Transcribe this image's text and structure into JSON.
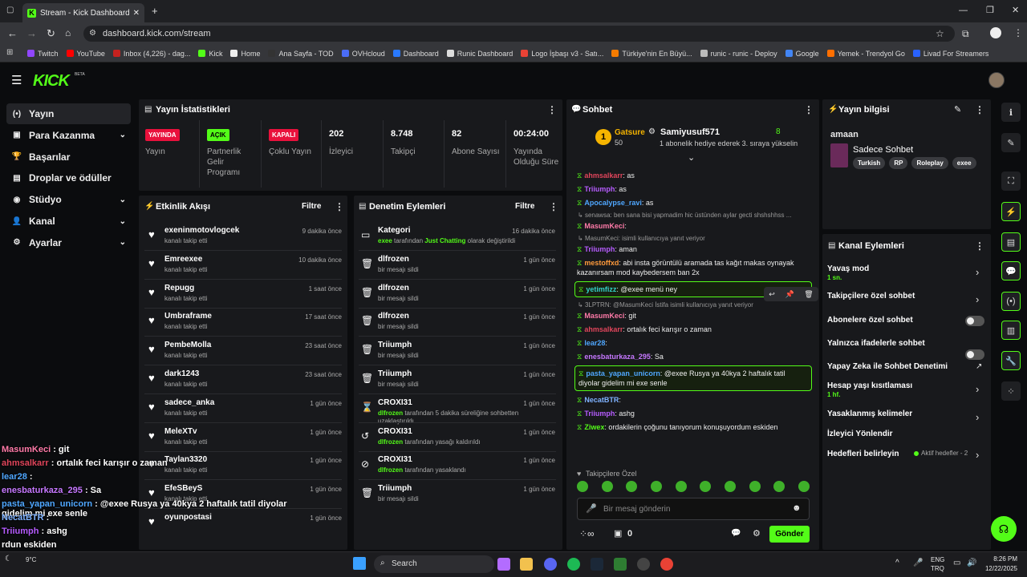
{
  "browser": {
    "tab_title": "Stream - Kick Dashboard",
    "url": "dashboard.kick.com/stream",
    "bookmarks": [
      "Twitch",
      "YouTube",
      "Inbox (4,226) - dag...",
      "Kick",
      "Home",
      "Ana Sayfa - TOD",
      "OVHcloud",
      "Dashboard",
      "Runic Dashboard",
      "Logo İşbaşı v3 - Satı...",
      "Türkiye'nin En Büyü...",
      "runic - runic - Deploy",
      "Google",
      "Yemek - Trendyol Go",
      "Livad For Streamers"
    ]
  },
  "header": {
    "logo": "KICK",
    "beta": "BETA"
  },
  "sidebar": {
    "items": [
      {
        "label": "Yayın",
        "icon": "(•)",
        "chevron": ""
      },
      {
        "label": "Para Kazanma",
        "icon": "▣",
        "chevron": "⌄"
      },
      {
        "label": "Başarılar",
        "icon": "🏆",
        "chevron": ""
      },
      {
        "label": "Droplar ve ödüller",
        "icon": "▤",
        "chevron": ""
      },
      {
        "label": "Stüdyo",
        "icon": "◉",
        "chevron": "⌄"
      },
      {
        "label": "Kanal",
        "icon": "👤",
        "chevron": "⌄"
      },
      {
        "label": "Ayarlar",
        "icon": "⚙",
        "chevron": "⌄"
      }
    ]
  },
  "stats": {
    "title": "Yayın İstatistikleri",
    "items": [
      {
        "badge": "YAYINDA",
        "label": "Yayın"
      },
      {
        "badge": "AÇIK",
        "label": "Partnerlik Gelir Programı"
      },
      {
        "badge": "KAPALI",
        "label": "Çoklu Yayın"
      },
      {
        "value": "202",
        "label": "İzleyici"
      },
      {
        "value": "8.748",
        "label": "Takipçi"
      },
      {
        "value": "82",
        "label": "Abone Sayısı"
      },
      {
        "value": "00:24:00",
        "label": "Yayında Olduğu Süre"
      }
    ]
  },
  "activity": {
    "title": "Etkinlik Akışı",
    "filter": "Filtre",
    "rows": [
      {
        "name": "exeninmotovlogcek",
        "action": "kanalı takip etti",
        "time": "9 dakika önce"
      },
      {
        "name": "Emreexee",
        "action": "kanalı takip etti",
        "time": "10 dakika önce"
      },
      {
        "name": "Repugg",
        "action": "kanalı takip etti",
        "time": "1 saat önce"
      },
      {
        "name": "Umbraframe",
        "action": "kanalı takip etti",
        "time": "17 saat önce"
      },
      {
        "name": "PembeMolla",
        "action": "kanalı takip etti",
        "time": "23 saat önce"
      },
      {
        "name": "dark1243",
        "action": "kanalı takip etti",
        "time": "23 saat önce"
      },
      {
        "name": "sadece_anka",
        "action": "kanalı takip etti",
        "time": "1 gün önce"
      },
      {
        "name": "MeleXTv",
        "action": "kanalı takip etti",
        "time": "1 gün önce"
      },
      {
        "name": "Taylan3320",
        "action": "kanalı takip etti",
        "time": "1 gün önce"
      },
      {
        "name": "EfeSBeyS",
        "action": "kanalı takip etti",
        "time": "1 gün önce"
      },
      {
        "name": "oyunpostasi",
        "action": "",
        "time": "1 gün önce"
      }
    ]
  },
  "moderation": {
    "title": "Denetim Eylemleri",
    "filter": "Filtre",
    "rows": [
      {
        "icon": "▭",
        "name": "Kategori",
        "pre": "exee",
        "mid": " tarafından ",
        "post": "Just Chatting",
        "tail": " olarak değiştirildi",
        "time": "16 dakika önce"
      },
      {
        "icon": "🗑",
        "name": "dlfrozen",
        "pre": "",
        "mid": "bir mesajı sildi",
        "post": "",
        "tail": "",
        "time": "1 gün önce"
      },
      {
        "icon": "🗑",
        "name": "dlfrozen",
        "pre": "",
        "mid": "bir mesajı sildi",
        "post": "",
        "tail": "",
        "time": "1 gün önce"
      },
      {
        "icon": "🗑",
        "name": "dlfrozen",
        "pre": "",
        "mid": "bir mesajı sildi",
        "post": "",
        "tail": "",
        "time": "1 gün önce"
      },
      {
        "icon": "🗑",
        "name": "Triiumph",
        "pre": "",
        "mid": "bir mesajı sildi",
        "post": "",
        "tail": "",
        "time": "1 gün önce"
      },
      {
        "icon": "🗑",
        "name": "Triiumph",
        "pre": "",
        "mid": "bir mesajı sildi",
        "post": "",
        "tail": "",
        "time": "1 gün önce"
      },
      {
        "icon": "⌛",
        "name": "CROXI31",
        "pre": "dlfrozen",
        "mid": " tarafından 5 dakika süreliğine sohbetten uzaklaştırıldı",
        "post": "",
        "tail": "",
        "time": "1 gün önce"
      },
      {
        "icon": "↺",
        "name": "CROXI31",
        "pre": "dlfrozen",
        "mid": " tarafından yasağı kaldırıldı",
        "post": "",
        "tail": "",
        "time": "1 gün önce"
      },
      {
        "icon": "⊘",
        "name": "CROXI31",
        "pre": "dlfrozen",
        "mid": " tarafından yasaklandı",
        "post": "",
        "tail": "",
        "time": "1 gün önce"
      },
      {
        "icon": "🗑",
        "name": "Triiumph",
        "pre": "",
        "mid": "bir mesajı sildi",
        "post": "",
        "tail": "",
        "time": "1 gün önce"
      }
    ]
  },
  "chat": {
    "title": "Sohbet",
    "pinned": {
      "tier": "Gatsure",
      "tier_count": "50",
      "user": "Samiyusuf571",
      "count": "8",
      "message": "1 abonelik hediye ederek 3. sıraya yükselin"
    },
    "messages": [
      {
        "user": "ahmsalkarr",
        "color": "#e0455b",
        "text": ": as"
      },
      {
        "user": "Triiumph",
        "color": "#b65cff",
        "text": ": as"
      },
      {
        "user": "Apocalypse_ravi",
        "color": "#4fa7ff",
        "text": ": as"
      },
      {
        "reply": "senawsa: ben sana bisi yapmadim hic üstünden aylar gecti shshshhss ..."
      },
      {
        "user": "MasumKeci",
        "color": "#ff7aa8",
        "text": ":"
      },
      {
        "reply": "MasumKeci: isimli kullanıcıya yanıt veriyor"
      },
      {
        "user": "Triiumph",
        "color": "#b65cff",
        "text": ": aman"
      },
      {
        "user": "mestoffxd",
        "color": "#ff9a3c",
        "text": ": abi insta görüntülü aramada tas kağıt makas oynayak kazanırsam mod kaybedersem ban 2x"
      },
      {
        "user": "yetimfizz",
        "color": "#34d1c9",
        "text": ": @exee menü ney",
        "highlight": true
      },
      {
        "reply": "3LPTRN: @MasumKeci İstifa isimli kullanıcıya yanıt veriyor"
      },
      {
        "user": "MasumKeci",
        "color": "#ff7aa8",
        "text": ": git"
      },
      {
        "user": "ahmsalkarr",
        "color": "#e0455b",
        "text": ": ortalık feci karışır o zaman"
      },
      {
        "user": "lear28",
        "color": "#4fa7ff",
        "text": ":"
      },
      {
        "user": "enesbaturkaza_295",
        "color": "#c678ff",
        "text": ": Sa"
      },
      {
        "user": "pasta_yapan_unicorn",
        "color": "#4fa7ff",
        "text": ": @exee Rusya ya 40kya 2 haftalık tatil diyolar gidelim mi exe senle",
        "highlight": true
      },
      {
        "user": "NecatBTR",
        "color": "#7fb2ff",
        "text": ":"
      },
      {
        "user": "Triiumph",
        "color": "#b65cff",
        "text": ": ashg"
      },
      {
        "user": "Ziwex",
        "color": "#53fc18",
        "text": ": ordakilerin çoğunu tanıyorum konuşuyordum eskiden"
      }
    ],
    "followers_only": "Takipçilere Özel",
    "input_placeholder": "Bir mesaj gönderin",
    "points": "0",
    "send": "Gönder"
  },
  "stream_info": {
    "title": "Yayın bilgisi",
    "stream_title": "amaan",
    "category": "Sadece Sohbet",
    "tags": [
      "Turkish",
      "RP",
      "Roleplay",
      "exee"
    ]
  },
  "channel_actions": {
    "title": "Kanal Eylemleri",
    "items": [
      {
        "label": "Yavaş mod",
        "sub": "1 sn.",
        "control": "chevron"
      },
      {
        "label": "Takipçilere özel sohbet",
        "sub": "",
        "control": "chevron"
      },
      {
        "label": "Abonelere özel sohbet",
        "sub": "",
        "control": "toggle"
      },
      {
        "label": "Yalnızca ifadelerle sohbet",
        "sub": "",
        "control": "toggle"
      },
      {
        "label": "Yapay Zeka ile Sohbet Denetimi",
        "sub": "",
        "control": "external"
      },
      {
        "label": "Hesap yaşı kısıtlaması",
        "sub": "1 hf.",
        "control": "chevron"
      },
      {
        "label": "Yasaklanmış kelimeler",
        "sub": "",
        "control": "chevron"
      },
      {
        "label": "İzleyici Yönlendir",
        "sub": "",
        "control": "none"
      },
      {
        "label": "Hedefleri belirleyin",
        "sub": "",
        "control": "goal",
        "goal_text": "Aktif hedefler - 2"
      }
    ]
  },
  "overlay_chat": [
    {
      "user": "MasumKeci",
      "color": "#ff7aa8",
      "text": " : git"
    },
    {
      "user": "ahmsalkarr",
      "color": "#e0455b",
      "text": " : ortalık feci karışır o zaman"
    },
    {
      "user": "lear28",
      "color": "#4fa7ff",
      "text": " :"
    },
    {
      "user": "enesbaturkaza_295",
      "color": "#c678ff",
      "text": " : Sa"
    },
    {
      "user": "pasta_yapan_unicorn",
      "color": "#4fa7ff",
      "text": " : @exee Rusya ya 40kya 2 haftalık tatil diyolar gidelim mi exe senle"
    },
    {
      "user": "NecatBTR",
      "color": "#7fb2ff",
      "text": " :"
    },
    {
      "user": "Triiumph",
      "color": "#b65cff",
      "text": " : ashg"
    },
    {
      "user": "",
      "color": "#fff",
      "text": "rdun eskiden"
    }
  ],
  "taskbar": {
    "search": "Search",
    "weather": "9°C",
    "lang": "ENG",
    "lang2": "TRQ",
    "time": "8:26 PM",
    "date": "12/22/2025"
  },
  "colors": {
    "accent": "#53fc18",
    "live": "#e9113c",
    "panel": "#18191c"
  }
}
